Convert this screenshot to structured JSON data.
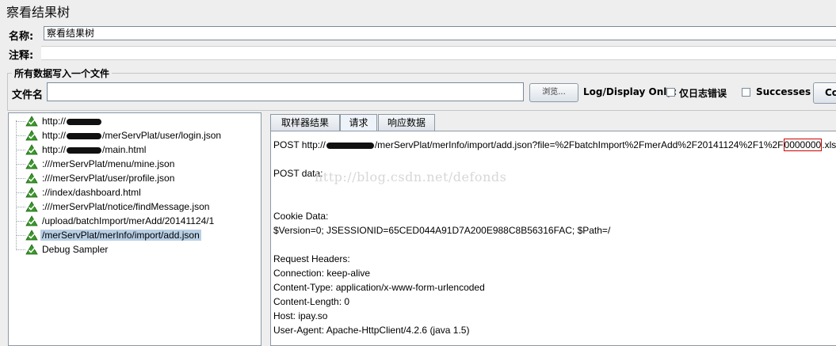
{
  "window": {
    "title": "察看结果树"
  },
  "name_row": {
    "label": "名称:",
    "value": "察看结果树"
  },
  "comment_row": {
    "label": "注释:"
  },
  "file_group": {
    "title": "所有数据写入一个文件",
    "file_label": "文件名",
    "file_value": "",
    "browse_label": "浏览...",
    "log_display_label": "Log/Display Only:",
    "errors_only_label": "仅日志错误",
    "successes_label": "Successes",
    "configure_label": "Co"
  },
  "tree": {
    "items": [
      {
        "label": "http://",
        "redacted": true,
        "suffix": ""
      },
      {
        "label": "http://",
        "redacted": true,
        "suffix": "/merServPlat/user/login.json"
      },
      {
        "label": "http://",
        "redacted": true,
        "suffix": "/main.html"
      },
      {
        "label": ":///merServPlat/menu/mine.json"
      },
      {
        "label": ":///merServPlat/user/profile.json"
      },
      {
        "label": "://index/dashboard.html"
      },
      {
        "label": ":///merServPlat/notice/findMessage.json"
      },
      {
        "label": "/upload/batchImport/merAdd/20141124/1"
      },
      {
        "label": "/merServPlat/merInfo/import/add.json",
        "selected": true
      },
      {
        "label": "Debug Sampler"
      }
    ],
    "icon": "sampler-success-icon"
  },
  "tabs": [
    {
      "label": "取样器结果"
    },
    {
      "label": "请求",
      "active": true
    },
    {
      "label": "响应数据"
    }
  ],
  "request": {
    "line1_prefix": "POST http://",
    "line1_mid": "/merServPlat/merInfo/import/add.json?file=%2FbatchImport%2FmerAdd%2F20141124%2F1%2F",
    "line1_highlight": "0000000",
    "line1_suffix": ".xls",
    "post_data_label": "POST data:",
    "cookie_label": "Cookie Data:",
    "cookie_value": "$Version=0; JSESSIONID=65CED044A91D7A200E988C8B56316FAC; $Path=/",
    "headers_label": "Request Headers:",
    "headers": [
      "Connection: keep-alive",
      "Content-Type: application/x-www-form-urlencoded",
      "Content-Length: 0",
      "Host: ipay.so",
      "User-Agent: Apache-HttpClient/4.2.6 (java 1.5)"
    ]
  },
  "watermark": "http://blog.csdn.net/defonds",
  "colors": {
    "selected_bg": "#b8cfe5",
    "highlight_border": "#cc0000",
    "icon_green": "#3a9a2a"
  }
}
